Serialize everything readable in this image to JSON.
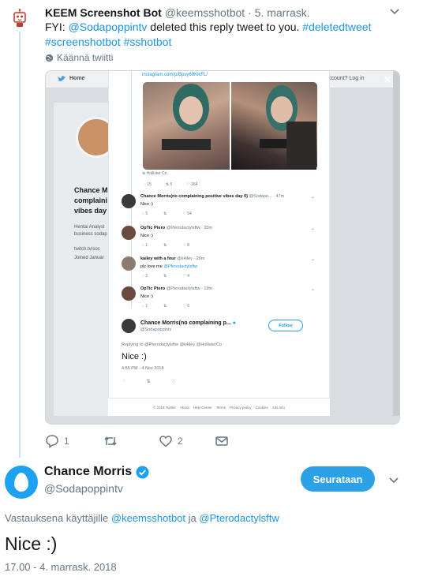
{
  "bot_tweet": {
    "name": "KEEM Screenshot Bot",
    "handle": "@keemsshotbot",
    "date": "5. marrask.",
    "text_prefix": "FYI: ",
    "mention": "@Sodapoppintv",
    "text_mid": " deleted this reply tweet to you. ",
    "hashtags": "#deletedtweet #screenshotbot #sshotbot",
    "translate": "Käännä twiitti",
    "reply_count": "1",
    "like_count": "2"
  },
  "screenshot": {
    "nav_home": "Home",
    "nav_right": "ccount? Log in",
    "bg_name": "Chance M complaini vibes day",
    "bg_bio": "Hentai Analyst business sodap",
    "bg_links": "twitch.tv/soc Joined Januar",
    "url": "instagram.com/p/Bpvy69KlkFL/",
    "photo_caption": "Hollister Co.",
    "top_actions": [
      "15",
      "5",
      "264"
    ],
    "replies": [
      {
        "name": "Chance Morris(no complaining positive vibes day 0)",
        "handle": "@Sodapo... · 47m",
        "text": "Nice :)",
        "actions": [
          "5",
          "",
          "54"
        ],
        "avatar_color": "#3a3a3a"
      },
      {
        "name": "OpTic Ptero",
        "handle": "@Pterodactylsftw · 20m",
        "text": "Nice :)",
        "actions": [
          "1",
          "",
          "8"
        ],
        "avatar_color": "#6b4a3f"
      },
      {
        "name": "kailey with a four",
        "handle": "@k4iley · 20m",
        "text_prefix": "plz love me ",
        "text_mention": "@Pterodactylsftw",
        "actions": [
          "2",
          "",
          "4"
        ],
        "avatar_color": "#8a7d70"
      },
      {
        "name": "OpTic Ptero",
        "handle": "@Pterodactylsftw · 19m",
        "text": "Nice :)",
        "actions": [
          "1",
          "",
          "6"
        ],
        "avatar_color": "#6b4a3f"
      }
    ],
    "focus": {
      "name": "Chance Morris(no complaining p...",
      "handle": "@Sodapoppintv",
      "follow": "Follow",
      "replying": "Replying to @Pterodactylsftw @k4iley @HollisterCo",
      "text": "Nice :)",
      "time": "4:55 PM - 4 Nov 2018"
    },
    "footer": [
      "© 2018 Twitter",
      "About",
      "Help Center",
      "Terms",
      "Privacy policy",
      "Cookies",
      "Ads info"
    ]
  },
  "main_tweet": {
    "name": "Chance Morris",
    "handle": "@Sodapoppintv",
    "follow_label": "Seurataan",
    "replying_prefix": "Vastauksena käyttäjille ",
    "replying_user1": "@keemsshotbot",
    "replying_and": " ja ",
    "replying_user2": "@Pterodactylsftw",
    "text": "Nice :)",
    "timestamp": "17.00 - 4. marrask. 2018"
  },
  "colors": {
    "link": "#1b95e0",
    "follow_button": "#2da1e8",
    "verified": "#1da1f2",
    "muted": "#657786"
  }
}
